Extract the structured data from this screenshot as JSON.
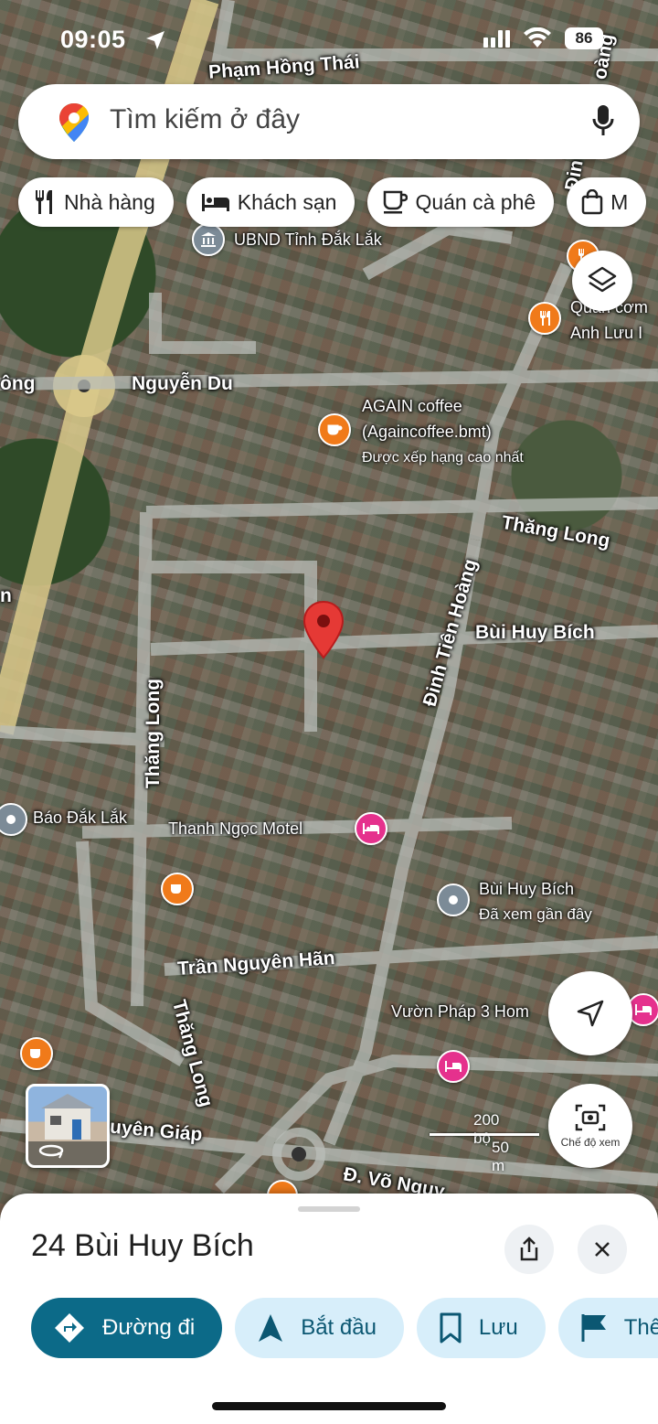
{
  "status_bar": {
    "time": "09:05",
    "battery": "86"
  },
  "search": {
    "placeholder": "Tìm kiếm ở đây"
  },
  "chips": [
    {
      "label": "Nhà hàng",
      "icon": "fork-knife-icon"
    },
    {
      "label": "Khách sạn",
      "icon": "bed-icon"
    },
    {
      "label": "Quán cà phê",
      "icon": "coffee-cup-icon"
    },
    {
      "label": "M",
      "icon": "shopping-bag-icon"
    }
  ],
  "map": {
    "streets": {
      "pham_hong_thai": "Phạm Hồng Thái",
      "nguyen_du": "Nguyễn Du",
      "ong": "ông",
      "thang_long_1": "Thăng Long",
      "thang_long_2": "Thăng Long",
      "thang_long_3": "Thăng Long",
      "bui_huy_bich": "Bùi Huy Bích",
      "dinh_tien_hoang": "Đinh Tiên Hoàng",
      "tran_nguyen_han": "Trần Nguyên Hãn",
      "nguyen_giap": "uyên Giáp",
      "vo_nguyen": "Đ. Võ Nguy",
      "dinh_top": "Đin",
      "hoang_top": "oàng",
      "n_left": "n"
    },
    "places": {
      "ubnd": "UBND Tỉnh Đắk Lắk",
      "quan_com_1": "Quán cơm",
      "quan_com_2": "Anh Lưu I",
      "again_1": "AGAIN coffee",
      "again_2": "(Againcoffee.bmt)",
      "again_sub": "Được xếp hạng cao nhất",
      "bao_dak_lak": "Báo Đắk Lắk",
      "thanh_ngoc": "Thanh Ngọc Motel",
      "bui_huy_bich_place": "Bùi Huy Bích",
      "bui_huy_bich_sub": "Đã xem gần đây",
      "vuon_phap": "Vườn Pháp 3 Hom"
    },
    "scale": {
      "feet": "200 bộ",
      "meters": "50 m"
    },
    "view_mode_label": "Chế độ xem"
  },
  "sheet": {
    "title": "24 Bùi Huy Bích",
    "actions": [
      {
        "label": "Đường đi",
        "icon": "directions-icon"
      },
      {
        "label": "Bắt đầu",
        "icon": "navigation-arrow-icon"
      },
      {
        "label": "Lưu",
        "icon": "bookmark-icon"
      },
      {
        "label": "Thê",
        "icon": "flag-icon"
      }
    ]
  },
  "colors": {
    "primary": "#0c6a88",
    "action_bg": "#d7eefa",
    "pin_red": "#e53935",
    "poi_orange": "#f07a1a",
    "poi_pink": "#e5318d"
  }
}
